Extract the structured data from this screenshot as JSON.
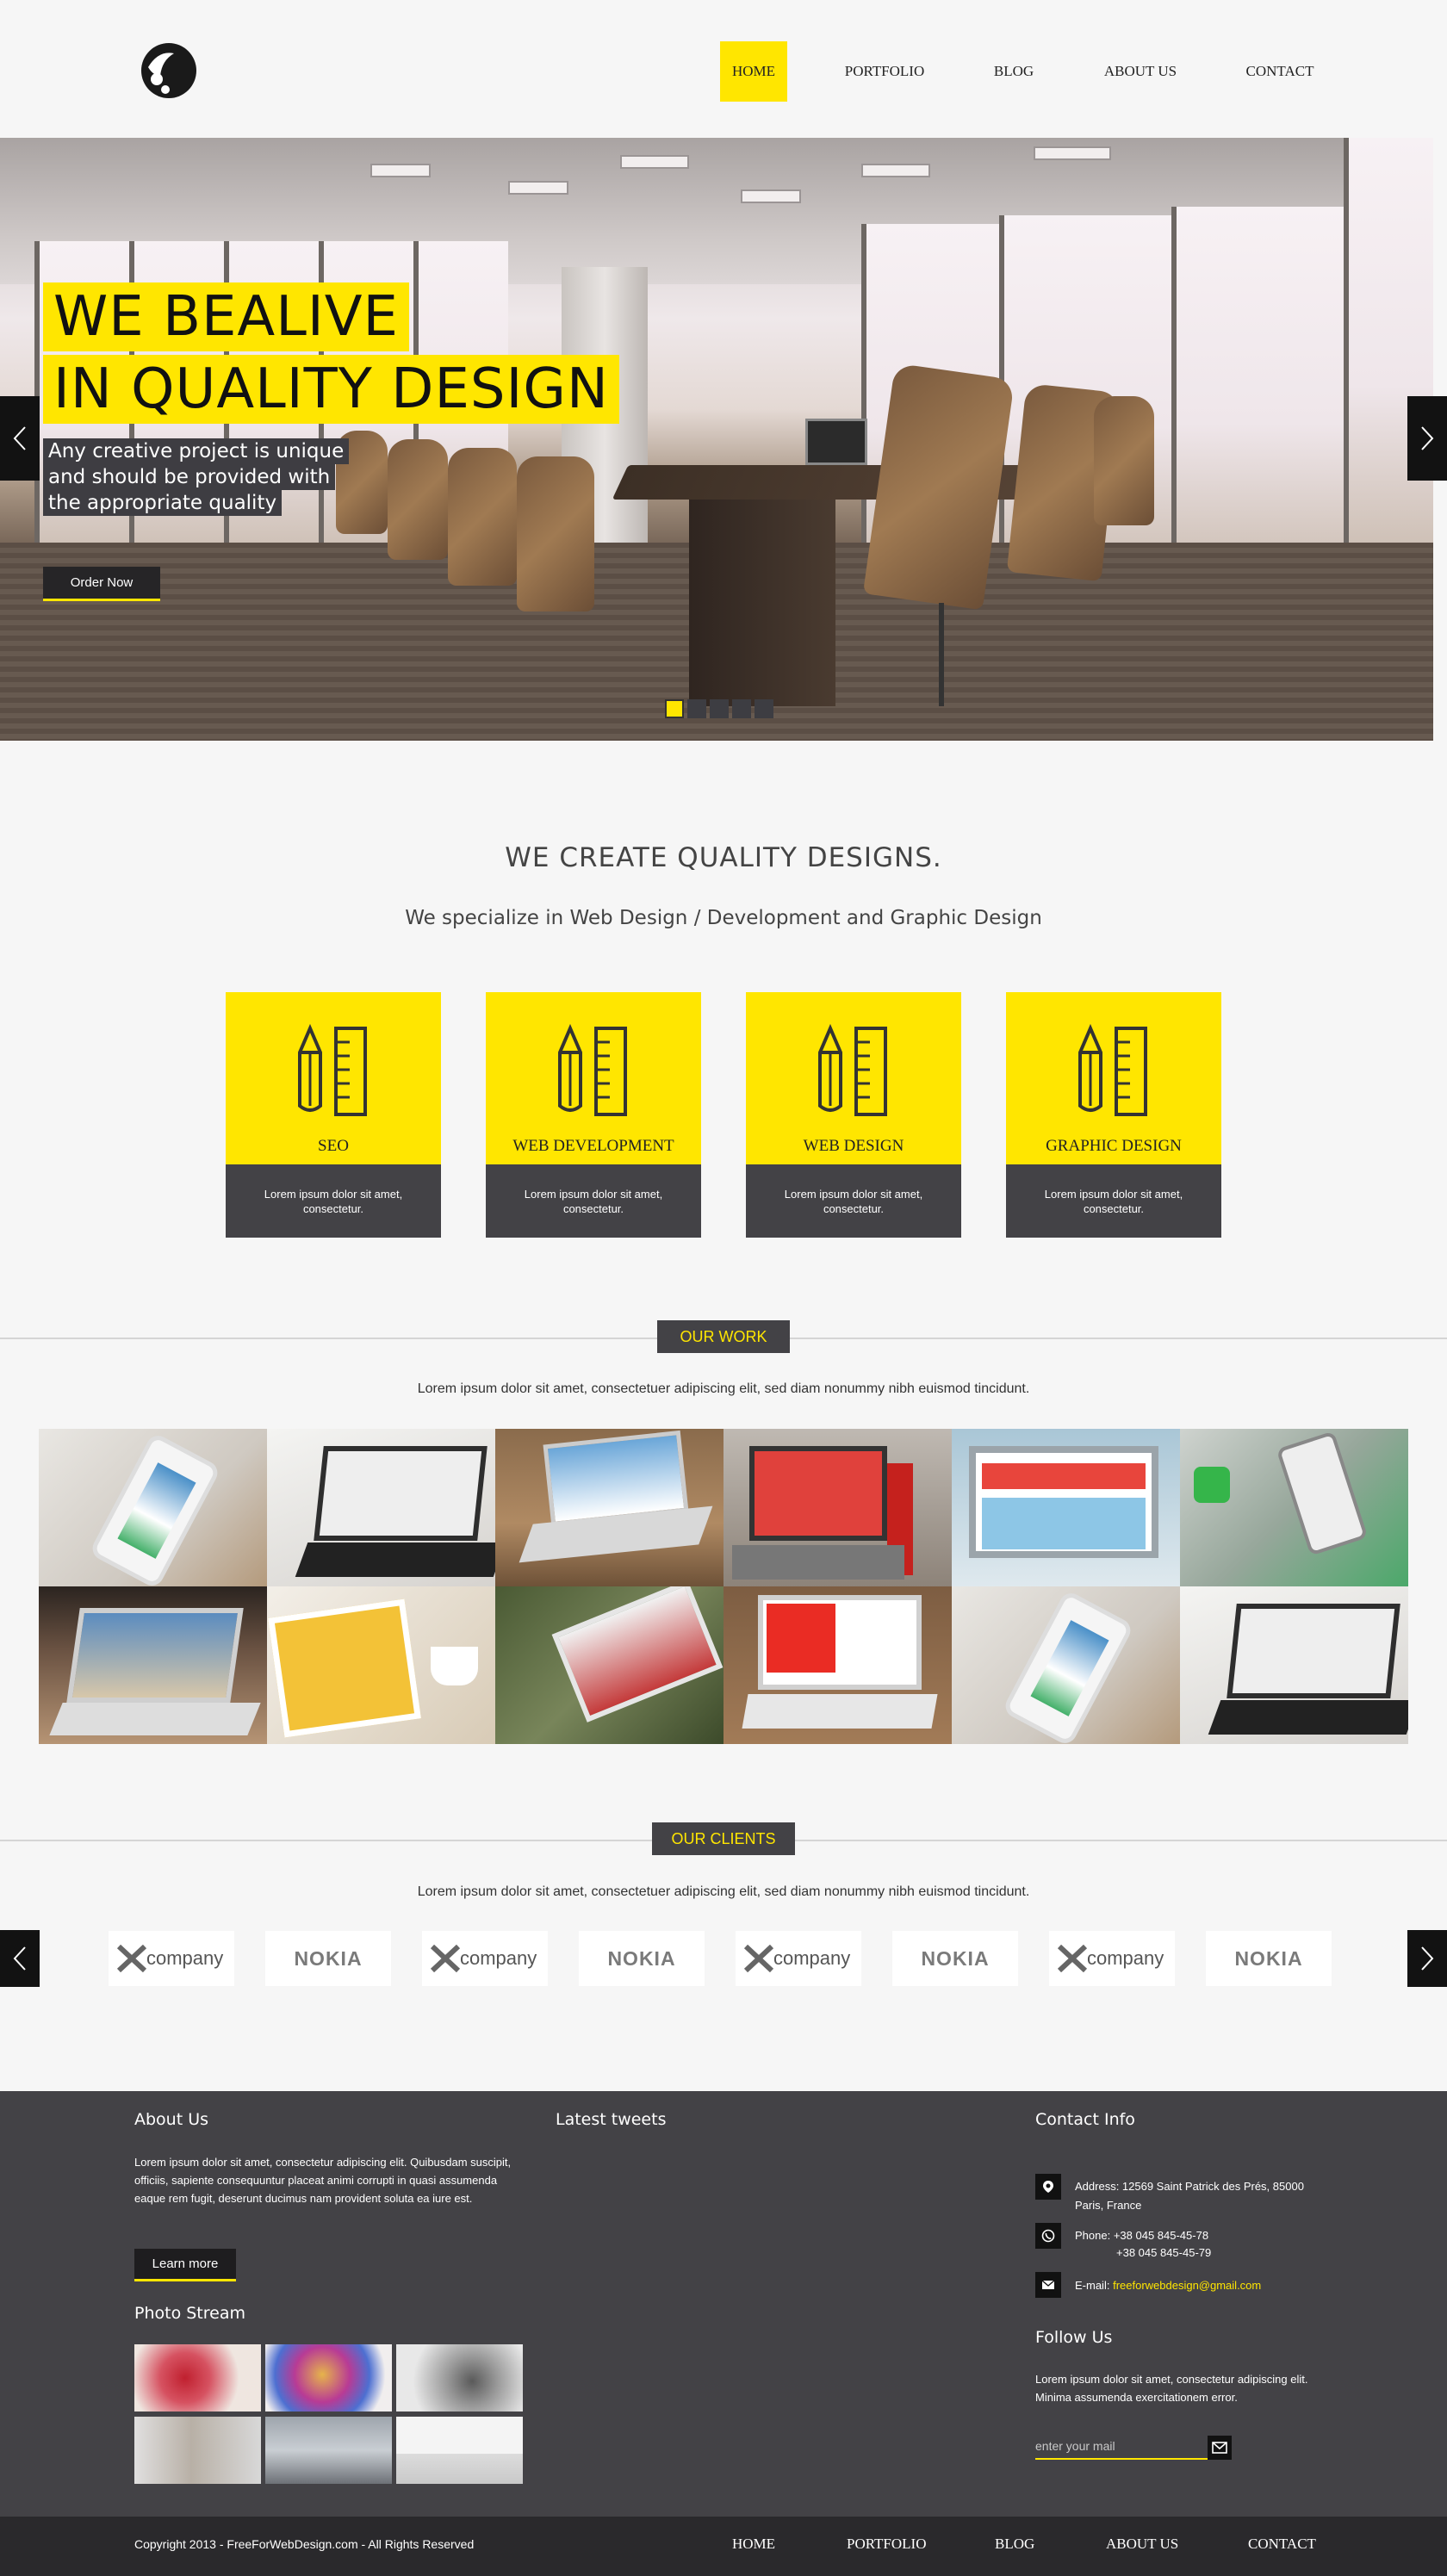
{
  "nav": {
    "items": [
      "HOME",
      "PORTFOLIO",
      "BLOG",
      "ABOUT US",
      "CONTACT"
    ],
    "active": "HOME"
  },
  "hero": {
    "title_line1": "WE BEALIVE",
    "title_line2": "IN QUALITY DESIGN",
    "sub_line1": "Any creative project is unique",
    "sub_line2": "and should be provided with",
    "sub_line3": "the appropriate quality",
    "cta": "Order Now",
    "slide_count": 5,
    "active_slide": 1
  },
  "intro": {
    "title": "WE CREATE QUALITY DESIGNS.",
    "subtitle": "We specialize in Web Design / Development and Graphic Design"
  },
  "services": [
    {
      "label": "SEO",
      "text": "Lorem ipsum dolor sit amet, consectetur."
    },
    {
      "label": "WEB DEVELOPMENT",
      "text": "Lorem ipsum dolor sit amet, consectetur."
    },
    {
      "label": "WEB DESIGN",
      "text": "Lorem ipsum dolor sit amet, consectetur."
    },
    {
      "label": "GRAPHIC DESIGN",
      "text": "Lorem ipsum dolor sit amet, consectetur."
    }
  ],
  "our_work": {
    "heading": "OUR WORK",
    "description": "Lorem ipsum dolor sit amet, consectetuer adipiscing elit, sed diam nonummy nibh euismod tincidunt."
  },
  "our_clients": {
    "heading": "OUR CLIENTS",
    "description": "Lorem ipsum dolor sit amet, consectetuer adipiscing elit, sed diam nonummy nibh euismod tincidunt.",
    "logos": [
      "company",
      "NOKIA",
      "company",
      "NOKIA",
      "company",
      "NOKIA",
      "company",
      "NOKIA"
    ]
  },
  "footer": {
    "about": {
      "heading": "About Us",
      "text": "Lorem ipsum dolor sit amet, consectetur adipiscing elit. Quibusdam suscipit, officiis, sapiente consequuntur placeat animi corrupti in quasi assumenda eaque rem fugit, deserunt ducimus nam provident soluta ea iure est.",
      "button": "Learn more"
    },
    "photo_stream": {
      "heading": "Photo Stream"
    },
    "tweets": {
      "heading": "Latest tweets"
    },
    "contact": {
      "heading": "Contact Info",
      "address_line1": "Address: 12569 Saint Patrick des Prés, 85000",
      "address_line2": "Paris, France",
      "phone_line1": "Phone: +38 045 845-45-78",
      "phone_line2": "+38 045 845-45-79",
      "email_label": "E-mail:",
      "email": "freeforwebdesign@gmail.com"
    },
    "follow": {
      "heading": "Follow Us",
      "text": "Lorem ipsum dolor sit amet, consectetur adipiscing elit. Minima assumenda exercitationem error.",
      "placeholder": "enter your mail"
    },
    "copyright": "Copyright 2013 - FreeForWebDesign.com - All Rights Reserved",
    "bottom_nav": [
      "HOME",
      "PORTFOLIO",
      "BLOG",
      "ABOUT US",
      "CONTACT"
    ]
  },
  "colors": {
    "accent": "#ffe600",
    "dark": "#434246",
    "background": "#f6f6f6"
  },
  "icons": [
    "logo-icon",
    "chevron-left-icon",
    "chevron-right-icon",
    "pencil-ruler-icon",
    "map-pin-icon",
    "whatsapp-icon",
    "envelope-icon",
    "x-company-logo-icon"
  ]
}
